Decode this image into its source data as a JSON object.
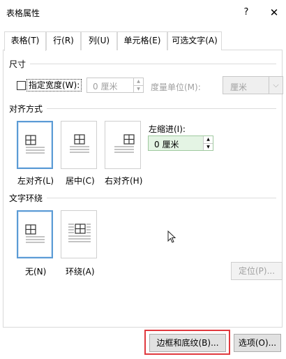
{
  "dialog": {
    "title": "表格属性",
    "help_glyph": "?",
    "close_glyph": "✕"
  },
  "tabs": [
    {
      "label": "表格(T)",
      "active": true
    },
    {
      "label": "行(R)",
      "active": false
    },
    {
      "label": "列(U)",
      "active": false
    },
    {
      "label": "单元格(E)",
      "active": false
    },
    {
      "label": "可选文字(A)",
      "active": false
    }
  ],
  "size_section": {
    "heading": "尺寸",
    "specify_width_label": "指定宽度(W):",
    "specify_width_checked": false,
    "width_value": "0 厘米",
    "unit_label": "度量单位(M):",
    "unit_value": "厘米"
  },
  "alignment_section": {
    "heading": "对齐方式",
    "options": [
      {
        "label": "左对齐(L)",
        "selected": true
      },
      {
        "label": "居中(C)",
        "selected": false
      },
      {
        "label": "右对齐(H)",
        "selected": false
      }
    ],
    "indent_label": "左缩进(I):",
    "indent_value": "0 厘米"
  },
  "wrap_section": {
    "heading": "文字环绕",
    "options": [
      {
        "label": "无(N)",
        "selected": true
      },
      {
        "label": "环绕(A)",
        "selected": false
      }
    ],
    "position_button": "定位(P)..."
  },
  "footer": {
    "borders_button": "边框和底纹(B)...",
    "options_button": "选项(O)..."
  },
  "colors": {
    "selection_border": "#5b9bd5",
    "highlight_red": "#e0393e",
    "indent_field_bg": "#e4f4e4"
  }
}
